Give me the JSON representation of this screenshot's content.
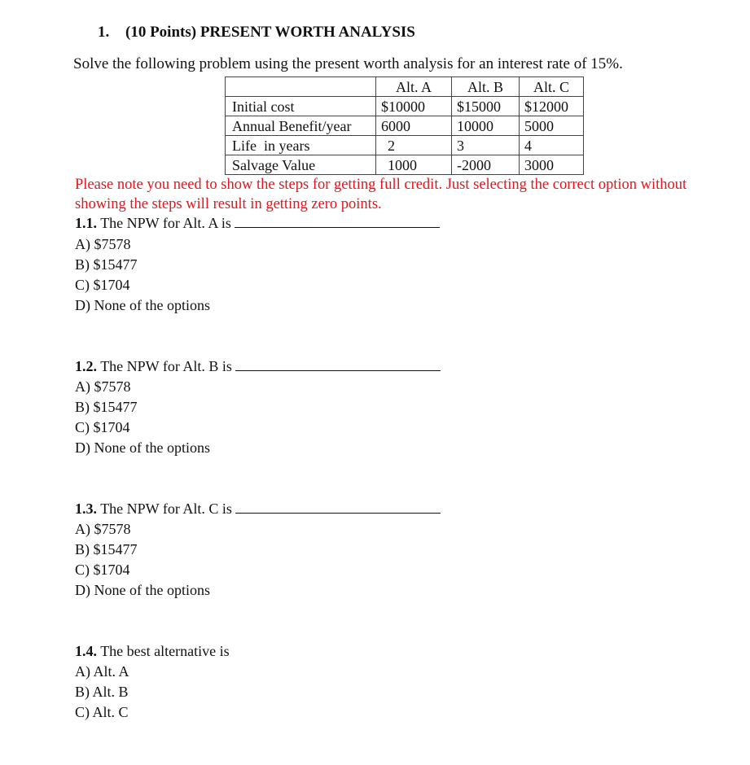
{
  "document": {
    "title_number": "1.",
    "title": "(10 Points) PRESENT WORTH ANALYSIS",
    "intro": "Solve the following problem using the present worth analysis for an interest rate of 15%.",
    "table": {
      "headers": [
        "",
        "Alt. A",
        "Alt. B",
        "Alt. C"
      ],
      "rows": [
        [
          "Initial cost",
          "$10000",
          "$15000",
          "$12000"
        ],
        [
          "Annual Benefit/year",
          "6000",
          "10000",
          "5000"
        ],
        [
          "Life  in years",
          "2",
          "3",
          "4"
        ],
        [
          "Salvage Value",
          "1000",
          "-2000",
          "3000"
        ]
      ]
    },
    "note": "Please note you need to show the steps for getting full credit. Just selecting the correct option without showing the steps will result in getting zero points.",
    "note_color": "#e8141b",
    "questions": [
      {
        "number": "1.1.",
        "text": "The NPW for Alt. A is",
        "options": [
          "A) $7578",
          "B) $15477",
          "C) $1704",
          "D) None of the options"
        ]
      },
      {
        "number": "1.2.",
        "text": "The NPW for Alt. B is",
        "options": [
          "A) $7578",
          "B) $15477",
          "C) $1704",
          "D) None of the options"
        ]
      },
      {
        "number": "1.3.",
        "text": "The NPW for Alt. C is",
        "options": [
          "A) $7578",
          "B) $15477",
          "C) $1704",
          "D) None of the options"
        ]
      },
      {
        "number": "1.4.",
        "text": "The best alternative is",
        "options": [
          "A) Alt. A",
          "B) Alt. B",
          "C) Alt. C"
        ]
      }
    ]
  }
}
